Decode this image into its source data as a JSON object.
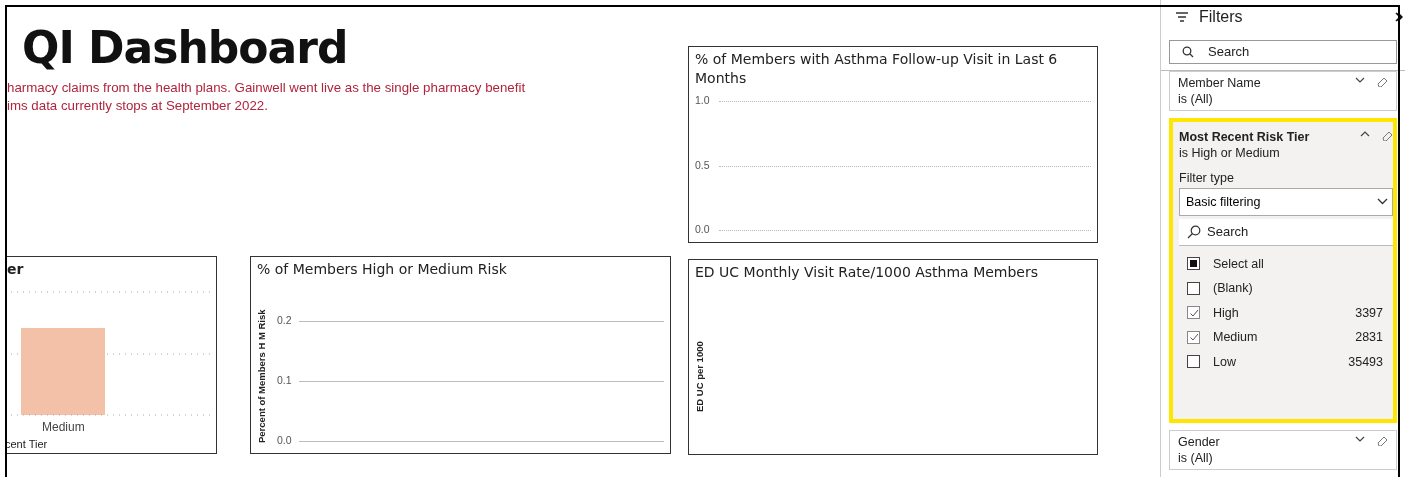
{
  "report": {
    "title": "QI Dashboard",
    "notes": [
      "harmacy claims from the health plans. Gainwell went live as the single pharmacy benefit",
      "ims data currently stops at September 2022."
    ],
    "visuals": [
      {
        "kind": "bars",
        "title": "er",
        "category": "Medium",
        "xlabel": "cent Tier"
      },
      {
        "kind": "lines",
        "chart": {
          "title": "% of Members High or Medium Risk",
          "ylabel": "Percent of Members H M Risk",
          "yticks": [
            "0.2",
            "0.1",
            "0.0"
          ]
        }
      },
      {
        "kind": "dotted",
        "chart": {
          "title": "% of Members with Asthma Follow-up Visit in Last 6 Months",
          "yticks": [
            "1.0",
            "0.5",
            "0.0"
          ]
        }
      },
      {
        "kind": "empty",
        "chart": {
          "title": "ED UC Monthly Visit Rate/1000 Asthma Members",
          "ylabel": "ED UC per 1000"
        }
      }
    ]
  },
  "filters": {
    "title": "Filters",
    "search": {
      "placeholder": "Search"
    },
    "cards": [
      {
        "name": "Member Name",
        "summary": "is (All)",
        "expanded": false,
        "highlighted": false
      },
      {
        "name": "Most Recent Risk Tier",
        "summary": "is High or Medium",
        "expanded": true,
        "highlighted": true,
        "filter_type_label": "Filter type",
        "filter_type": "Basic filtering",
        "search": {
          "placeholder": "Search"
        },
        "options": [
          {
            "label": "Select all",
            "checked": false,
            "indeterminate": true
          },
          {
            "label": "(Blank)",
            "checked": false,
            "indeterminate": false
          },
          {
            "label": "High",
            "checked": true,
            "indeterminate": false,
            "count": "3397"
          },
          {
            "label": "Medium",
            "checked": true,
            "indeterminate": false,
            "count": "2831"
          },
          {
            "label": "Low",
            "checked": false,
            "indeterminate": false,
            "count": "35493"
          }
        ]
      },
      {
        "name": "Gender",
        "summary": "is (All)",
        "expanded": false,
        "highlighted": false
      }
    ]
  }
}
